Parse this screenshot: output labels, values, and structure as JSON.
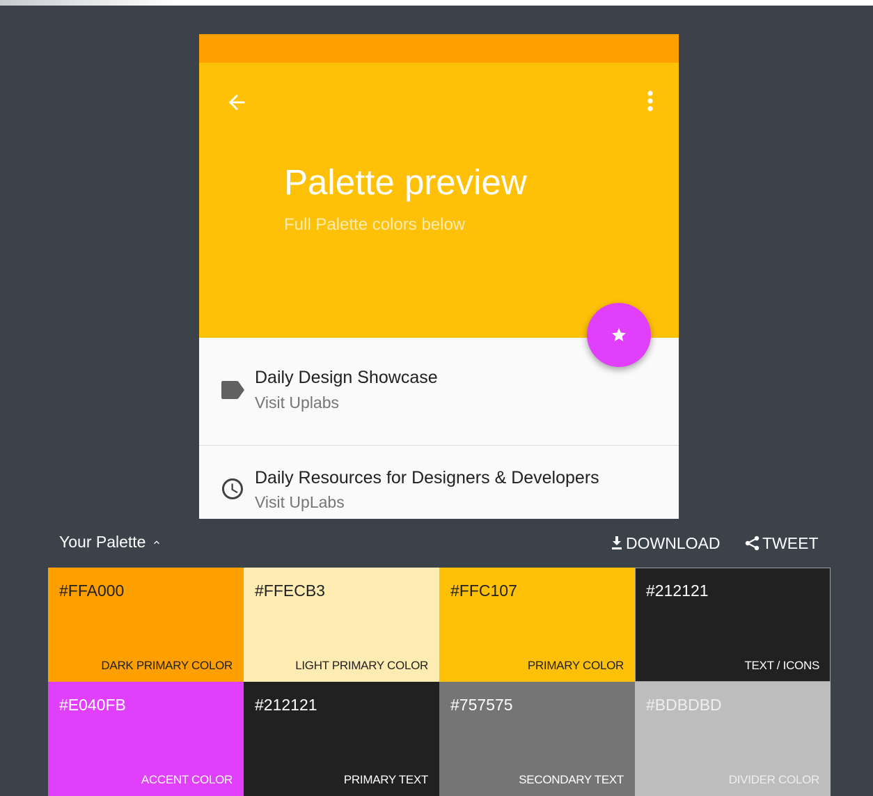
{
  "colors": {
    "dark_primary": "#FFA000",
    "light_primary": "#FFECB3",
    "primary": "#FFC107",
    "text_icons": "#212121",
    "accent": "#E040FB",
    "primary_text": "#212121",
    "secondary_text": "#757575",
    "divider": "#BDBDBD",
    "background": "#3B424A"
  },
  "preview": {
    "back_icon": "arrow-back-icon",
    "more_icon": "more-vert-icon",
    "title": "Palette preview",
    "subtitle": "Full Palette colors below",
    "fab_icon": "star-icon",
    "list": [
      {
        "icon": "label-icon",
        "title": "Daily Design Showcase",
        "subtitle": "Visit Uplabs"
      },
      {
        "icon": "clock-icon",
        "title": "Daily Resources for Designers & Developers",
        "subtitle": "Visit UpLabs"
      }
    ]
  },
  "palette": {
    "title": "Your Palette",
    "download_label": "DOWNLOAD",
    "tweet_label": "TWEET",
    "swatches": [
      {
        "hex": "#FFA000",
        "role": "DARK PRIMARY COLOR"
      },
      {
        "hex": "#FFECB3",
        "role": "LIGHT PRIMARY COLOR"
      },
      {
        "hex": "#FFC107",
        "role": "PRIMARY COLOR"
      },
      {
        "hex": "#212121",
        "role": "TEXT / ICONS"
      },
      {
        "hex": "#E040FB",
        "role": "ACCENT COLOR"
      },
      {
        "hex": "#212121",
        "role": "PRIMARY TEXT"
      },
      {
        "hex": "#757575",
        "role": "SECONDARY TEXT"
      },
      {
        "hex": "#BDBDBD",
        "role": "DIVIDER COLOR"
      }
    ]
  }
}
